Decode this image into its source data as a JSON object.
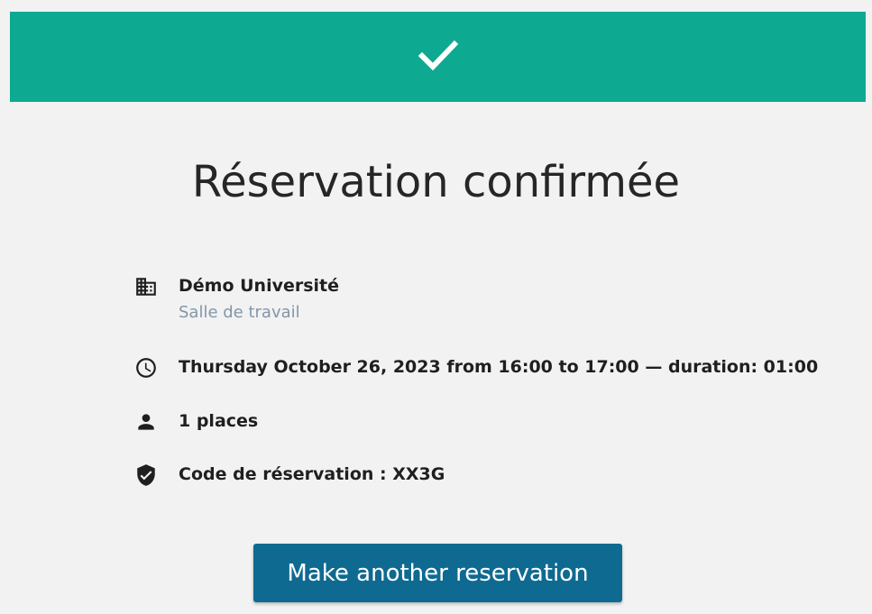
{
  "colors": {
    "banner": "#0ea991",
    "button": "#0f6a91",
    "icon": "#1f1f1f"
  },
  "banner": {
    "icon": "checkmark-icon"
  },
  "page": {
    "title": "Réservation confirmée"
  },
  "details": {
    "location": {
      "icon": "building-icon",
      "name": "Démo Université",
      "room": "Salle de travail"
    },
    "time": {
      "icon": "clock-icon",
      "text": "Thursday October 26, 2023 from 16:00 to 17:00 — duration: 01:00"
    },
    "people": {
      "icon": "person-icon",
      "text": "1 places"
    },
    "code": {
      "icon": "shield-check-icon",
      "text": "Code de réservation : XX3G"
    }
  },
  "actions": {
    "new_reservation_label": "Make another reservation"
  }
}
